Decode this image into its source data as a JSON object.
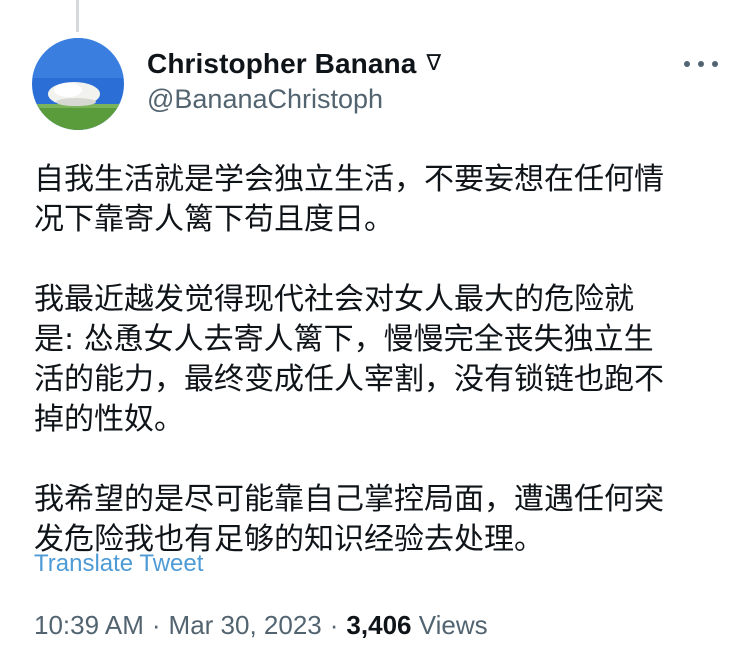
{
  "author": {
    "display_name": "Christopher Banana",
    "badge": "∇",
    "handle": "@BananaChristoph"
  },
  "icons": {
    "more": "more-horizontal-icon",
    "avatar": "avatar-image"
  },
  "tweet": {
    "paragraphs": [
      [
        "自我生活就是学会独立生活，不要妄想在任何情",
        "况下靠寄人篱下苟且度日。"
      ],
      [
        "我最近越发觉得现代社会对女人最大的危险就",
        "是: 怂恿女人去寄人篱下，慢慢完全丧失独立生",
        "活的能力，最终变成任人宰割，没有锁链也跑不",
        "掉的性奴。"
      ],
      [
        "我希望的是尽可能靠自己掌控局面，遭遇任何突",
        "发危险我也有足够的知识经验去处理。"
      ]
    ],
    "translate_label": "Translate Tweet"
  },
  "meta": {
    "time": "10:39 AM",
    "date": "Mar 30, 2023",
    "dot": "·",
    "views_count": "3,406",
    "views_label": "Views"
  },
  "colors": {
    "text": "#0f1419",
    "secondary": "#536471",
    "link": "#4e9bd6"
  }
}
